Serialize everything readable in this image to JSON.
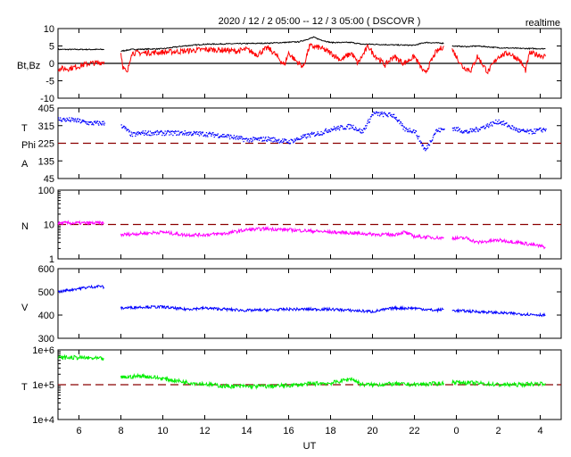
{
  "header": {
    "title": "2020 / 12 / 2   05:00 -- 12 / 3   05:00 ( DSCOVR )",
    "mode": "realtime"
  },
  "chart_data": [
    {
      "type": "line",
      "id": "mag",
      "ylabels": [
        "Bt,Bz"
      ],
      "ylim": [
        -10,
        10
      ],
      "yscale": "linear",
      "yticks": [
        10,
        5,
        0,
        -5,
        -10
      ],
      "tick_labels": [
        "10",
        "5",
        "0",
        "-5",
        "-10"
      ],
      "refline": {
        "value": 0,
        "style": "solid",
        "color": "#000000"
      },
      "series": [
        {
          "name": "Bt",
          "color": "#000000",
          "noise": 0.15,
          "segments": [
            [
              [
                0,
                4
              ],
              [
                2.2,
                4
              ]
            ],
            [
              [
                3.0,
                3.5
              ],
              [
                3.5,
                4
              ],
              [
                5,
                4.2
              ],
              [
                6,
                5
              ],
              [
                7,
                5.5
              ],
              [
                10,
                5.8
              ],
              [
                11.5,
                6.2
              ],
              [
                12.2,
                7.5
              ],
              [
                12.5,
                6.8
              ],
              [
                13,
                6
              ],
              [
                14,
                6
              ],
              [
                14.5,
                5.5
              ],
              [
                15,
                5.5
              ],
              [
                16,
                5.3
              ],
              [
                17,
                5.2
              ],
              [
                17.5,
                6
              ],
              [
                18.4,
                5.8
              ]
            ],
            [
              [
                18.8,
                5
              ],
              [
                19.5,
                4.8
              ],
              [
                20,
                5
              ],
              [
                21,
                4.5
              ],
              [
                22,
                4.3
              ],
              [
                23.25,
                4.2
              ]
            ]
          ]
        },
        {
          "name": "Bz",
          "color": "#ff0000",
          "noise": 0.8,
          "segments": [
            [
              [
                0,
                -1.5
              ],
              [
                0.5,
                -1.5
              ],
              [
                1,
                -0.8
              ],
              [
                1.5,
                0
              ],
              [
                2,
                0.2
              ],
              [
                2.2,
                0.5
              ]
            ],
            [
              [
                3.0,
                3
              ],
              [
                3.1,
                -1
              ],
              [
                3.3,
                -3
              ],
              [
                3.5,
                3
              ],
              [
                4,
                3
              ],
              [
                5,
                3.2
              ],
              [
                6,
                3.5
              ],
              [
                7,
                4
              ],
              [
                8,
                3.8
              ],
              [
                8.5,
                3.5
              ],
              [
                9,
                4
              ],
              [
                9.5,
                2.5
              ],
              [
                10,
                4.5
              ],
              [
                10.3,
                3
              ],
              [
                10.8,
                -0.5
              ],
              [
                11,
                3
              ],
              [
                11.3,
                1
              ],
              [
                11.7,
                -1
              ],
              [
                12,
                5
              ],
              [
                12.5,
                4.5
              ],
              [
                13,
                3
              ],
              [
                13.5,
                1
              ],
              [
                14,
                3
              ],
              [
                14.3,
                0
              ],
              [
                14.8,
                5
              ],
              [
                15,
                3
              ],
              [
                15.6,
                -0.5
              ],
              [
                16,
                2
              ],
              [
                16.5,
                0
              ],
              [
                17,
                2
              ],
              [
                17.5,
                -3
              ],
              [
                18,
                3
              ],
              [
                18.4,
                5
              ]
            ],
            [
              [
                18.8,
                4
              ],
              [
                19.3,
                -1
              ],
              [
                19.7,
                -2
              ],
              [
                20,
                2
              ],
              [
                20.5,
                -2.5
              ],
              [
                21,
                2
              ],
              [
                21.5,
                3
              ],
              [
                22,
                1
              ],
              [
                22.3,
                -2
              ],
              [
                22.5,
                3
              ],
              [
                23.25,
                2
              ]
            ]
          ]
        }
      ]
    },
    {
      "type": "scatter",
      "id": "phi",
      "ylabels": [
        "T",
        "Phi",
        "A"
      ],
      "ylim": [
        45,
        405
      ],
      "yscale": "linear",
      "yticks": [
        405,
        315,
        225,
        135,
        45
      ],
      "tick_labels": [
        "405",
        "315",
        "225",
        "135",
        "45"
      ],
      "refline": {
        "value": 225,
        "style": "dashed",
        "color": "#8b0000"
      },
      "series": [
        {
          "name": "Phi",
          "color": "#0000ff",
          "noise": 12,
          "segments": [
            [
              [
                0,
                350
              ],
              [
                0.8,
                345
              ],
              [
                1.5,
                330
              ],
              [
                2.2,
                330
              ]
            ],
            [
              [
                3,
                320
              ],
              [
                3.5,
                270
              ],
              [
                4,
                280
              ],
              [
                5,
                280
              ],
              [
                6,
                280
              ],
              [
                7,
                275
              ],
              [
                8,
                265
              ],
              [
                9,
                245
              ],
              [
                10,
                250
              ],
              [
                11,
                235
              ],
              [
                12,
                270
              ],
              [
                12.5,
                280
              ],
              [
                13,
                300
              ],
              [
                14,
                315
              ],
              [
                14.5,
                285
              ],
              [
                15,
                380
              ],
              [
                16,
                370
              ],
              [
                16.5,
                300
              ],
              [
                17,
                290
              ],
              [
                17.5,
                190
              ],
              [
                18,
                290
              ],
              [
                18.4,
                300
              ]
            ],
            [
              [
                18.8,
                305
              ],
              [
                19.5,
                285
              ],
              [
                20,
                300
              ],
              [
                21,
                340
              ],
              [
                22,
                290
              ],
              [
                22.5,
                285
              ],
              [
                23.25,
                300
              ]
            ]
          ]
        }
      ]
    },
    {
      "type": "line",
      "id": "density",
      "ylabels": [
        "N"
      ],
      "ylim": [
        1,
        100
      ],
      "yscale": "log",
      "yticks": [
        100,
        10,
        1
      ],
      "tick_labels": [
        "100",
        "10",
        "1"
      ],
      "refline": {
        "value": 10,
        "style": "dashed",
        "color": "#8b0000"
      },
      "series": [
        {
          "name": "N",
          "color": "#ff00ff",
          "noise": 0.05,
          "segments": [
            [
              [
                0,
                11
              ],
              [
                1,
                11
              ],
              [
                2.2,
                11
              ]
            ],
            [
              [
                3,
                5
              ],
              [
                4,
                5.5
              ],
              [
                5,
                6
              ],
              [
                6,
                5
              ],
              [
                7,
                5
              ],
              [
                8,
                5.5
              ],
              [
                9,
                7
              ],
              [
                10,
                7.5
              ],
              [
                11,
                7
              ],
              [
                12,
                6.5
              ],
              [
                13,
                6
              ],
              [
                14,
                5.7
              ],
              [
                15,
                5.2
              ],
              [
                16,
                5
              ],
              [
                16.5,
                6
              ],
              [
                17,
                4.5
              ],
              [
                18.4,
                4
              ]
            ],
            [
              [
                18.8,
                4
              ],
              [
                19.5,
                4
              ],
              [
                20,
                3
              ],
              [
                21,
                3.5
              ],
              [
                22,
                3
              ],
              [
                23.25,
                2.2
              ]
            ]
          ]
        }
      ]
    },
    {
      "type": "line",
      "id": "speed",
      "ylabels": [
        "V"
      ],
      "ylim": [
        300,
        600
      ],
      "yscale": "linear",
      "yticks": [
        600,
        500,
        400,
        300
      ],
      "tick_labels": [
        "600",
        "500",
        "400",
        "300"
      ],
      "refline": null,
      "series": [
        {
          "name": "V",
          "color": "#0000ff",
          "noise": 6,
          "segments": [
            [
              [
                0,
                500
              ],
              [
                1,
                515
              ],
              [
                2,
                525
              ],
              [
                2.2,
                520
              ]
            ],
            [
              [
                3,
                430
              ],
              [
                4,
                435
              ],
              [
                5,
                435
              ],
              [
                6,
                425
              ],
              [
                7,
                430
              ],
              [
                8,
                425
              ],
              [
                9,
                420
              ],
              [
                10,
                422
              ],
              [
                11,
                425
              ],
              [
                12,
                425
              ],
              [
                13,
                425
              ],
              [
                14,
                420
              ],
              [
                15,
                415
              ],
              [
                16,
                430
              ],
              [
                17,
                430
              ],
              [
                18,
                420
              ],
              [
                18.4,
                425
              ]
            ],
            [
              [
                18.8,
                420
              ],
              [
                20,
                415
              ],
              [
                21,
                410
              ],
              [
                22,
                405
              ],
              [
                23.25,
                400
              ]
            ]
          ]
        }
      ]
    },
    {
      "type": "line",
      "id": "temperature",
      "ylabels": [
        "T"
      ],
      "ylim": [
        10000,
        1000000
      ],
      "yscale": "log",
      "yticks": [
        1000000,
        100000,
        10000
      ],
      "tick_labels": [
        "1e+6",
        "1e+5",
        "1e+4"
      ],
      "refline": {
        "value": 100000,
        "style": "dashed",
        "color": "#8b0000"
      },
      "series": [
        {
          "name": "T",
          "color": "#00ee00",
          "noise": 0.06,
          "segments": [
            [
              [
                0,
                600000
              ],
              [
                1,
                600000
              ],
              [
                2.2,
                550000
              ]
            ],
            [
              [
                3,
                160000
              ],
              [
                4,
                180000
              ],
              [
                5,
                150000
              ],
              [
                6,
                120000
              ],
              [
                7,
                105000
              ],
              [
                8,
                90000
              ],
              [
                9,
                90000
              ],
              [
                10,
                90000
              ],
              [
                11,
                95000
              ],
              [
                12,
                105000
              ],
              [
                12.5,
                110000
              ],
              [
                13,
                110000
              ],
              [
                14,
                150000
              ],
              [
                14.5,
                100000
              ],
              [
                15,
                100000
              ],
              [
                16,
                105000
              ],
              [
                17,
                100000
              ],
              [
                18.4,
                110000
              ]
            ],
            [
              [
                18.8,
                120000
              ],
              [
                20,
                110000
              ],
              [
                21,
                100000
              ],
              [
                22,
                100000
              ],
              [
                23.25,
                110000
              ]
            ]
          ]
        }
      ]
    }
  ],
  "xaxis": {
    "label": "UT",
    "start_hour_ut": 5,
    "span_hours": 24,
    "tick_labels": [
      "6",
      "8",
      "10",
      "12",
      "14",
      "16",
      "18",
      "20",
      "22",
      "0",
      "2",
      "4"
    ]
  }
}
